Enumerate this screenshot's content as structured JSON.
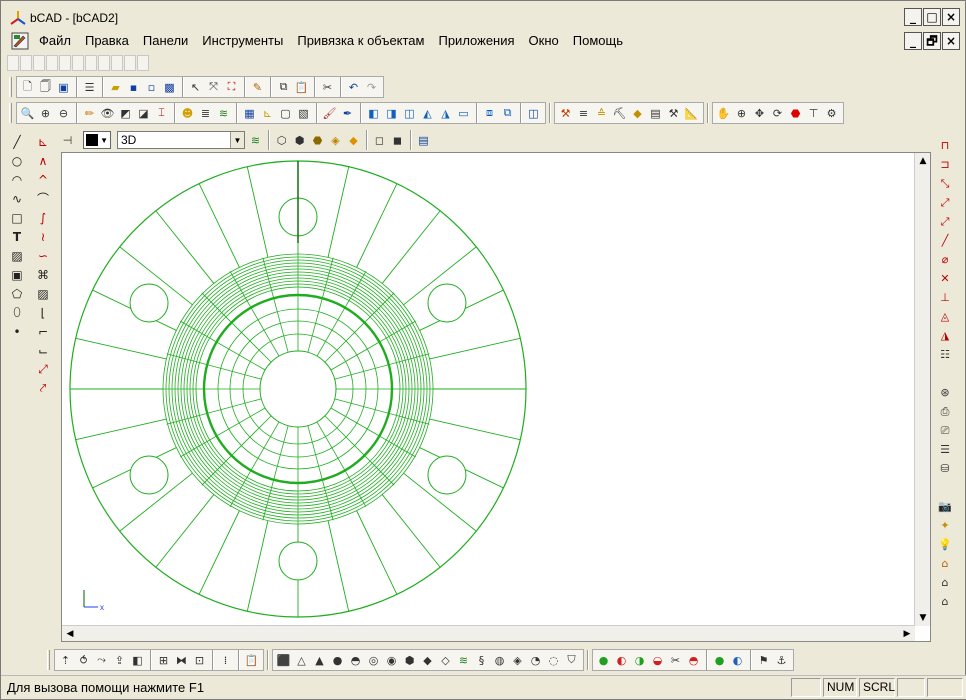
{
  "window": {
    "title": "bCAD - [bCAD2]",
    "controls": [
      "_",
      "□",
      "×"
    ],
    "mdi_controls": [
      "_",
      "🗗",
      "×"
    ]
  },
  "menu": [
    "Файл",
    "Правка",
    "Панели",
    "Инструменты",
    "Привязка к объектам",
    "Приложения",
    "Окно",
    "Помощь"
  ],
  "properties": {
    "view_mode": "3D",
    "line_color": "#000000"
  },
  "status": {
    "help_text": "Для вызова помощи нажмите F1",
    "panels": [
      "",
      "NUM",
      "SCRL",
      "",
      ""
    ]
  },
  "colors": {
    "drawing": "#1fad1f",
    "axis_dark": "#006400",
    "ucs": "#1e3cff"
  },
  "ucs_label": "x"
}
